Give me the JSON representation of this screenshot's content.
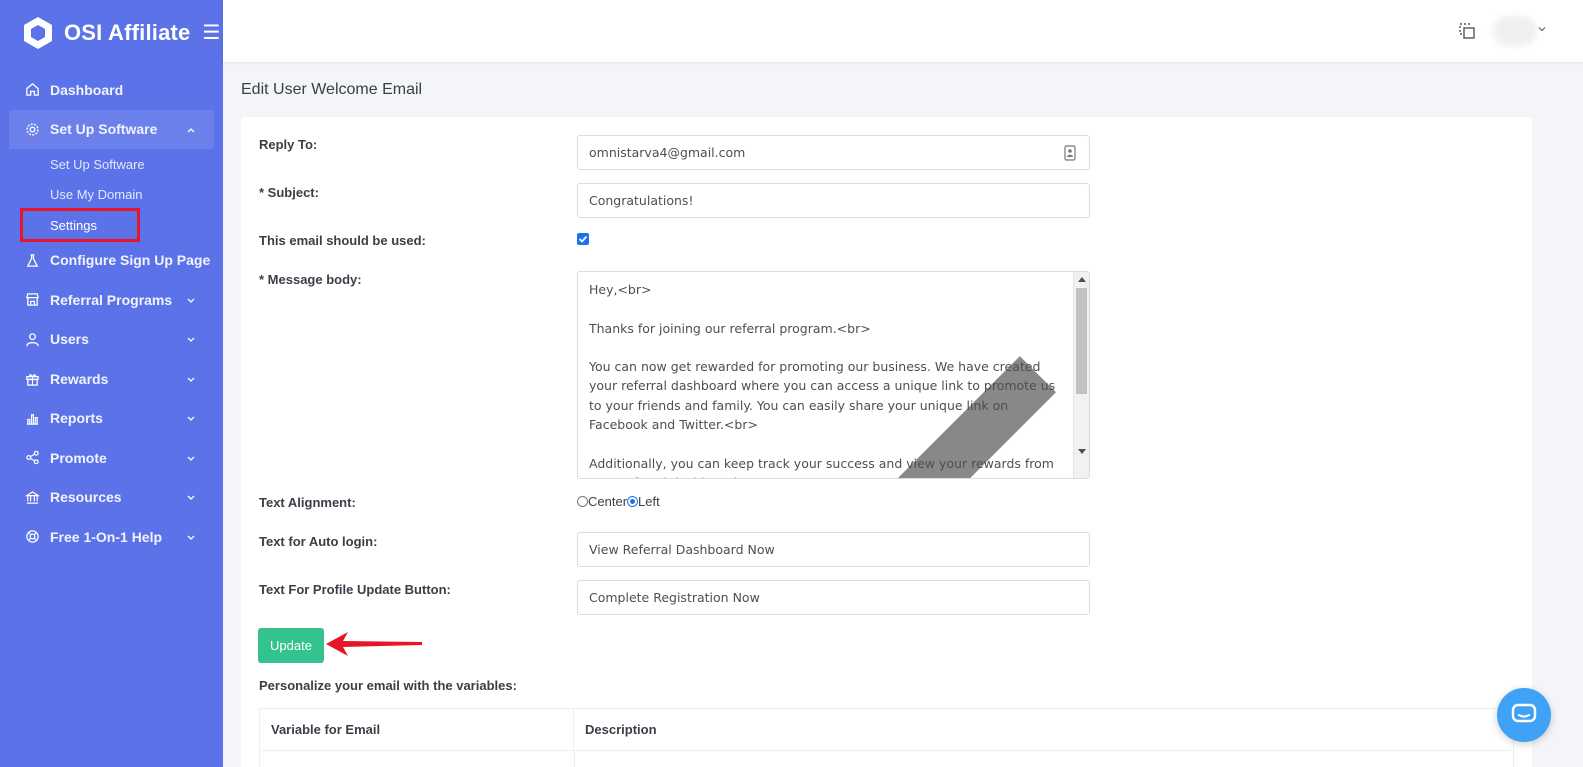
{
  "app": {
    "brand": "OSI Affiliate"
  },
  "sidebar": {
    "items": [
      {
        "label": "Dashboard",
        "icon": "home-icon"
      },
      {
        "label": "Set Up Software",
        "icon": "gear-icon",
        "expanded": true,
        "children": [
          {
            "label": "Set Up Software"
          },
          {
            "label": "Use My Domain"
          },
          {
            "label": "Settings",
            "selected": true
          }
        ]
      },
      {
        "label": "Configure Sign Up Page",
        "icon": "flask-icon"
      },
      {
        "label": "Referral Programs",
        "icon": "store-icon"
      },
      {
        "label": "Users",
        "icon": "user-icon"
      },
      {
        "label": "Rewards",
        "icon": "gift-icon"
      },
      {
        "label": "Reports",
        "icon": "bar-chart-icon"
      },
      {
        "label": "Promote",
        "icon": "share-icon"
      },
      {
        "label": "Resources",
        "icon": "bank-icon"
      },
      {
        "label": "Free 1-On-1 Help",
        "icon": "lifebuoy-icon"
      }
    ]
  },
  "page": {
    "title": "Edit User Welcome Email"
  },
  "form": {
    "reply_to": {
      "label": "Reply To:",
      "value": "omnistarva4@gmail.com"
    },
    "subject": {
      "label": "* Subject:",
      "value": "Congratulations!"
    },
    "used": {
      "label": "This email should be used:",
      "checked": true
    },
    "message": {
      "label": "* Message body:",
      "value": "Hey,<br>\n\nThanks for joining our referral program.<br>\n\nYou can now get rewarded for promoting our business. We have created your referral dashboard where you can access a unique link to promote us to your friends and family. You can easily share your unique link on Facebook and Twitter.<br>\n\nAdditionally, you can keep track your success and view your rewards from your referral dashboard."
    },
    "alignment": {
      "label": "Text Alignment:",
      "options": [
        "Center",
        "Left"
      ],
      "selected": "Left"
    },
    "auto_login": {
      "label": "Text for Auto login:",
      "value": "View Referral Dashboard Now"
    },
    "profile_update": {
      "label": "Text For Profile Update Button:",
      "value": "Complete Registration Now"
    },
    "submit_label": "Update"
  },
  "variables": {
    "title": "Personalize your email with the variables:",
    "columns": [
      "Variable for Email",
      "Description"
    ]
  },
  "colors": {
    "sidebar": "#5b72e8",
    "primary_button": "#34c38f",
    "annotation": "#e8142a",
    "chat": "#3fa2f7"
  }
}
